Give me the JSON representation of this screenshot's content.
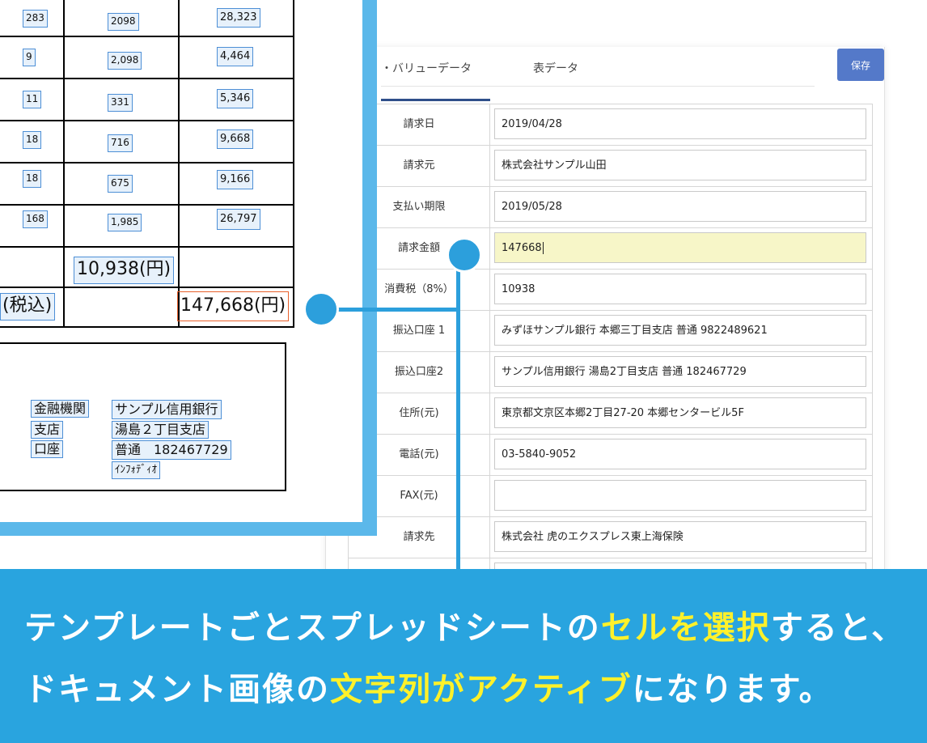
{
  "tabs": {
    "kv_label": "・バリューデータ",
    "table_label": "表データ"
  },
  "save_label": "保存",
  "form_rows": [
    {
      "label": "請求日",
      "value": "2019/04/28"
    },
    {
      "label": "請求元",
      "value": "株式会社サンプル山田"
    },
    {
      "label": "支払い期限",
      "value": "2019/05/28"
    },
    {
      "label": "請求金額",
      "value": "147668",
      "active": true
    },
    {
      "label": "消費税（8%）",
      "value": "10938"
    },
    {
      "label": "振込口座 1",
      "value": "みずほサンプル銀行 本郷三丁目支店 普通 9822489621"
    },
    {
      "label": "振込口座2",
      "value": "サンプル信用銀行 湯島2丁目支店 普通 182467729"
    },
    {
      "label": "住所(元)",
      "value": "東京都文京区本郷2丁目27-20 本郷センタービル5F"
    },
    {
      "label": "電話(元)",
      "value": "03-5840-9052"
    },
    {
      "label": "FAX(元)",
      "value": ""
    },
    {
      "label": "請求先",
      "value": "株式会社 虎のエクスプレス東上海保険"
    }
  ],
  "document": {
    "rows": [
      {
        "qty": "283",
        "price": "2098",
        "amount": "28,323"
      },
      {
        "qty": "9",
        "price": "2,098",
        "amount": "4,464"
      },
      {
        "qty": "11",
        "price": "331",
        "amount": "5,346"
      },
      {
        "qty": "18",
        "price": "716",
        "amount": "9,668"
      },
      {
        "qty": "18",
        "price": "675",
        "amount": "9,166"
      },
      {
        "qty": "168",
        "price": "1,985",
        "amount": "26,797"
      }
    ],
    "tax_amount": "10,938(円)",
    "total_label": "(税込)",
    "total_amount": "147,668(円)",
    "bank_labels": [
      "金融機関",
      "支店",
      "口座"
    ],
    "bank_values": [
      "サンプル信用銀行",
      "湯島２丁目支店",
      "普通　182467729",
      "ｲﾝﾌｫﾃﾞｨｵ"
    ]
  },
  "banner": {
    "line1_a": "テンプレートごとスプレッドシートの",
    "line1_hl": "セルを選択",
    "line1_b": "すると、",
    "line2_a": "ドキュメント画像の",
    "line2_hl": "文字列がアクティブ",
    "line2_b": "になります。"
  },
  "colors": {
    "accent": "#29a4df",
    "highlight_text": "#fff12a",
    "save_button": "#5479c9",
    "active_field": "#f7f6c8"
  }
}
